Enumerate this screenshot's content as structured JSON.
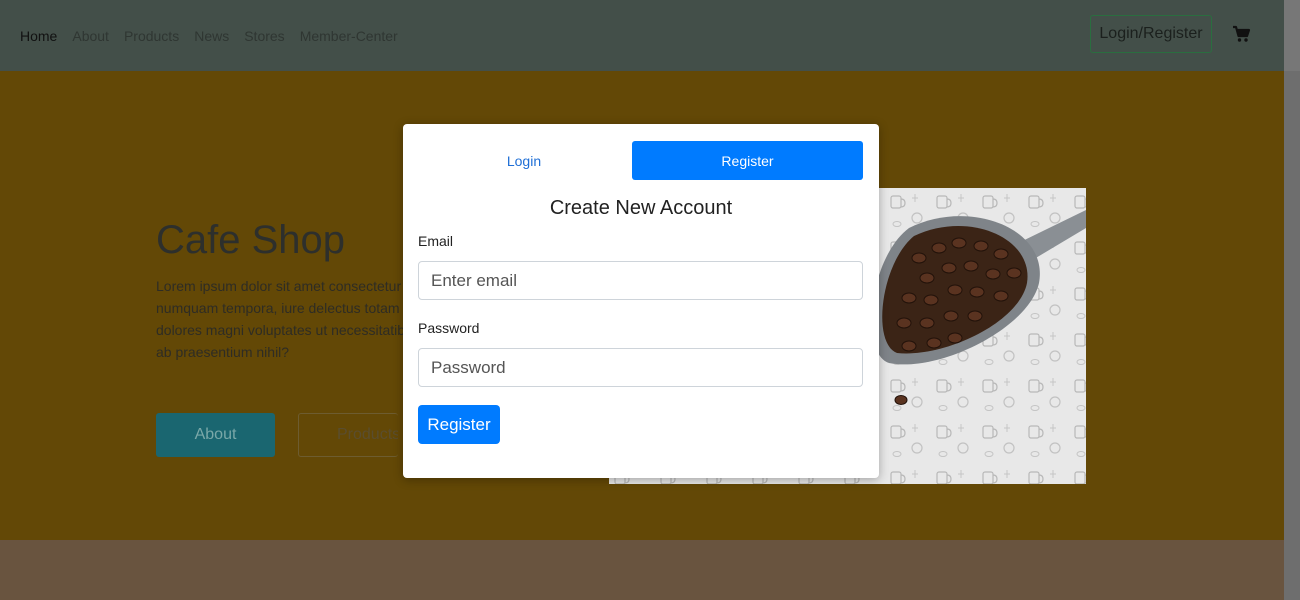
{
  "nav": {
    "links": [
      {
        "label": "Home"
      },
      {
        "label": "About"
      },
      {
        "label": "Products"
      },
      {
        "label": "News"
      },
      {
        "label": "Stores"
      },
      {
        "label": "Member-Center"
      }
    ],
    "login_register": "Login/Register",
    "cart_icon": "shopping-cart-icon"
  },
  "hero": {
    "title": "Cafe Shop",
    "text_lines": [
      "Lorem ipsum dolor sit amet consectetur a",
      "numquam tempora, iure delectus totam n",
      "dolores magni voluptates ut necessitatib",
      "ab praesentium nihil?"
    ],
    "about_button": "About",
    "products_button": "Products"
  },
  "modal": {
    "tabs": {
      "login": "Login",
      "register": "Register"
    },
    "title": "Create New Account",
    "email_label": "Email",
    "email_placeholder": "Enter email",
    "password_label": "Password",
    "password_placeholder": "Password",
    "submit": "Register"
  },
  "colors": {
    "primary": "#007bff",
    "navbar": "#434f49",
    "hero_bg": "#634806",
    "about_button": "#1a6670"
  }
}
